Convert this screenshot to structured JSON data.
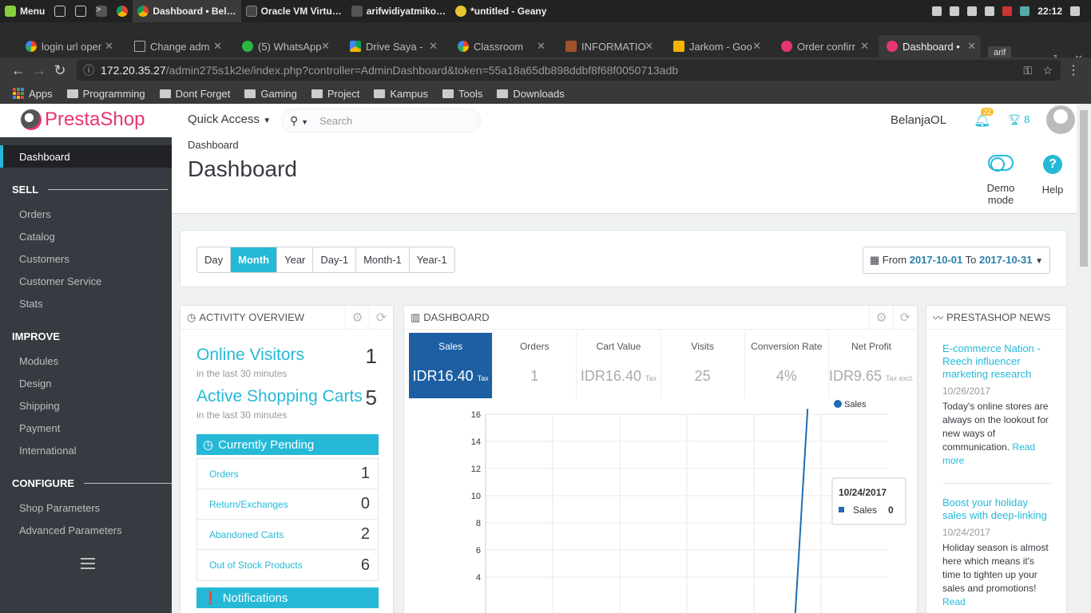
{
  "taskbar": {
    "menu_label": "Menu",
    "windows": [
      {
        "label": "Dashboard • Bel…",
        "active": true
      },
      {
        "label": "Oracle VM Virtu…",
        "active": false
      },
      {
        "label": "arifwidiyatmiko…",
        "active": false
      },
      {
        "label": "*untitled - Geany",
        "active": false
      }
    ],
    "clock": "22:12"
  },
  "browser": {
    "tabs": [
      {
        "label": "login url oper",
        "icon": "google-icon"
      },
      {
        "label": "Change adm",
        "icon": "document-icon"
      },
      {
        "label": "(5) WhatsApp",
        "icon": "whatsapp-icon"
      },
      {
        "label": "Drive Saya - ",
        "icon": "drive-icon"
      },
      {
        "label": "Classroom",
        "icon": "google-icon"
      },
      {
        "label": "INFORMATIO",
        "icon": "contact-icon"
      },
      {
        "label": "Jarkom - Goo",
        "icon": "slides-icon"
      },
      {
        "label": "Order confirr",
        "icon": "prestashop-icon"
      },
      {
        "label": "Dashboard •",
        "icon": "prestashop-icon"
      }
    ],
    "profile": "arif",
    "url_host": "172.20.35.27",
    "url_path": "/admin275s1k2ie/index.php?controller=AdminDashboard&token=55a18a65db898ddbf8f68f0050713adb",
    "bookmarks": [
      "Apps",
      "Programming",
      "Dont Forget",
      "Gaming",
      "Project",
      "Kampus",
      "Tools",
      "Downloads"
    ]
  },
  "header": {
    "logo_presta": "Presta",
    "logo_shop": "Shop",
    "quick_access": "Quick Access",
    "search_placeholder": "Search",
    "shop_name": "BelanjaOL",
    "notifications": "22",
    "trophies": "8"
  },
  "sidebar": {
    "active": "Dashboard",
    "sections": [
      {
        "title": "SELL",
        "items": [
          "Orders",
          "Catalog",
          "Customers",
          "Customer Service",
          "Stats"
        ]
      },
      {
        "title": "IMPROVE",
        "items": [
          "Modules",
          "Design",
          "Shipping",
          "Payment",
          "International"
        ]
      },
      {
        "title": "CONFIGURE",
        "items": [
          "Shop Parameters",
          "Advanced Parameters"
        ]
      }
    ]
  },
  "toolbar": {
    "breadcrumb": "Dashboard",
    "title": "Dashboard",
    "demo_mode": "Demo mode",
    "help": "Help"
  },
  "filters": {
    "periods": [
      "Day",
      "Month",
      "Year",
      "Day-1",
      "Month-1",
      "Year-1"
    ],
    "selected": "Month",
    "from_label": "From",
    "from": "2017-10-01",
    "to_label": "To",
    "to": "2017-10-31"
  },
  "activity": {
    "title": "ACTIVITY OVERVIEW",
    "online_visitors_label": "Online Visitors",
    "online_visitors": "1",
    "online_sub": "in the last 30 minutes",
    "active_carts_label": "Active Shopping Carts",
    "active_carts": "5",
    "carts_sub": "in the last 30 minutes",
    "pending_title": "Currently Pending",
    "pending": [
      {
        "label": "Orders",
        "value": "1"
      },
      {
        "label": "Return/Exchanges",
        "value": "0"
      },
      {
        "label": "Abandoned Carts",
        "value": "2"
      },
      {
        "label": "Out of Stock Products",
        "value": "6"
      }
    ],
    "notifications_title": "Notifications"
  },
  "dashboard": {
    "title": "DASHBOARD",
    "kpis": [
      {
        "label": "Sales",
        "value": "IDR16.40",
        "suffix": "Tax",
        "selected": true
      },
      {
        "label": "Orders",
        "value": "1",
        "suffix": "",
        "selected": false
      },
      {
        "label": "Cart Value",
        "value": "IDR16.40",
        "suffix": "Tax",
        "selected": false
      },
      {
        "label": "Visits",
        "value": "25",
        "suffix": "",
        "selected": false
      },
      {
        "label": "Conversion Rate",
        "value": "4%",
        "suffix": "",
        "selected": false
      },
      {
        "label": "Net Profit",
        "value": "IDR9.65",
        "suffix": "Tax excl.",
        "selected": false
      }
    ],
    "tooltip_date": "10/24/2017",
    "tooltip_series": "Sales",
    "tooltip_value": "0"
  },
  "chart_data": {
    "type": "line",
    "series": [
      {
        "name": "Sales",
        "color": "#1d6db5",
        "points": [
          [
            24,
            0
          ],
          [
            25,
            16.4
          ]
        ]
      }
    ],
    "x_range": [
      1,
      31
    ],
    "yticks": [
      4,
      6,
      8,
      10,
      12,
      14,
      16
    ],
    "ylim": [
      2,
      16
    ],
    "legend": "top-right",
    "grid": true
  },
  "news": {
    "title": "PRESTASHOP NEWS",
    "items": [
      {
        "title": "E-commerce Nation - Reech influencer marketing research",
        "date": "10/26/2017",
        "body": "Today's online stores are always on the lookout for new ways of communication.",
        "more": "Read more"
      },
      {
        "title": "Boost your holiday sales with deep-linking",
        "date": "10/24/2017",
        "body": "Holiday season is almost here which means it's time to tighten up your sales and promotions!",
        "more": "Read"
      }
    ]
  },
  "colors": {
    "accent": "#25b9d7",
    "sidebar": "#363a41",
    "kpi_selected": "#1d5fa2",
    "brand": "#e5366f"
  }
}
